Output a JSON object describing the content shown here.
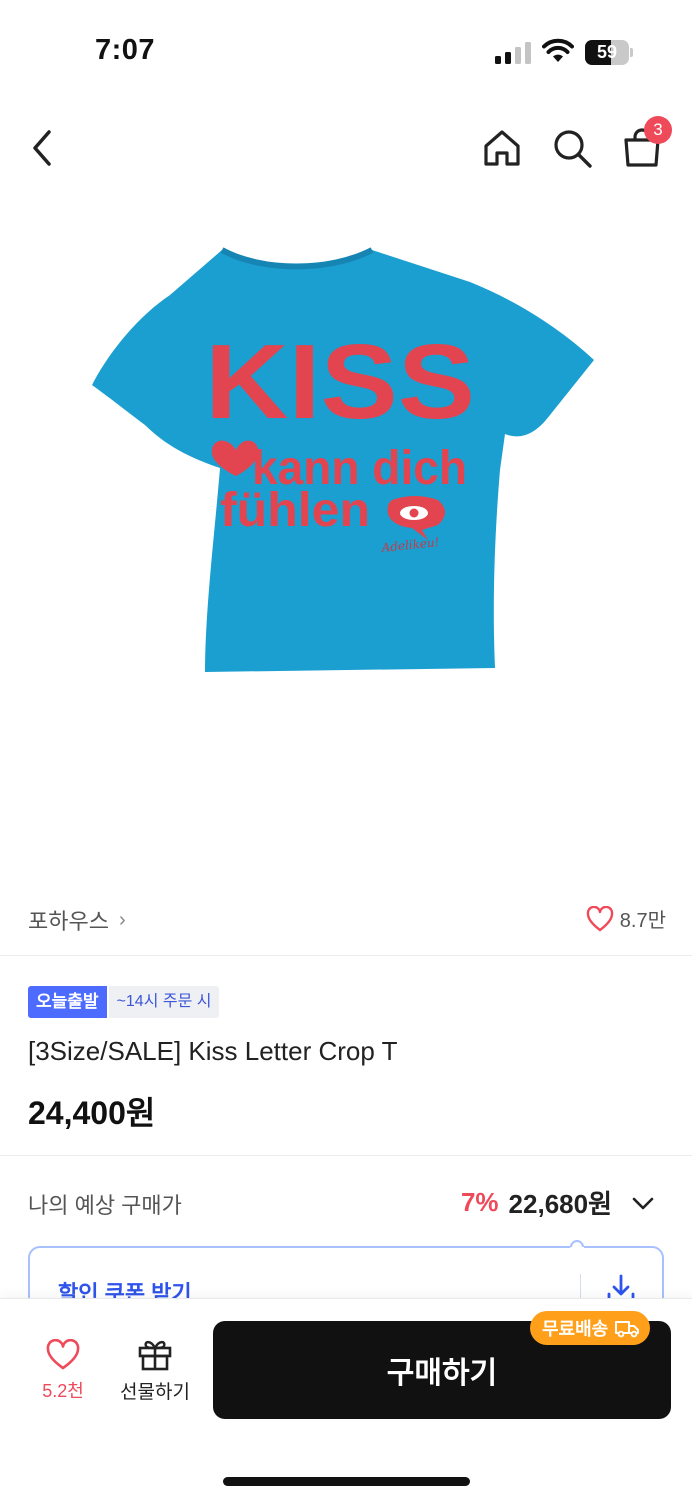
{
  "status_bar": {
    "time": "7:07",
    "battery": "59",
    "battery_level": 0.59
  },
  "nav": {
    "cart_count": "3"
  },
  "product_image": {
    "line1": "KISS",
    "line2": "kann dich",
    "line3": "fühlen",
    "signature": "Adelikeu!",
    "shirt_color": "#1b9fd1",
    "print_color": "#e2454f"
  },
  "brand": {
    "name": "포하우스",
    "chevron": "›",
    "likes": "8.7만"
  },
  "badges": {
    "shipping": "오늘출발",
    "cutoff": "~14시 주문 시"
  },
  "product": {
    "title": "[3Size/SALE] Kiss Letter Crop T",
    "price": "24,400원"
  },
  "expected": {
    "label": "나의 예상 구매가",
    "rate": "7%",
    "price": "22,680원"
  },
  "coupon": {
    "label": "할인 쿠폰 받기"
  },
  "bottom": {
    "like_count": "5.2천",
    "gift_label": "선물하기",
    "buy_label": "구매하기",
    "free_shipping": "무료배송"
  },
  "colors": {
    "accent_red": "#ef4a5a",
    "accent_blue": "#4e6bff",
    "free_ship_orange": "#ff9f1a"
  }
}
